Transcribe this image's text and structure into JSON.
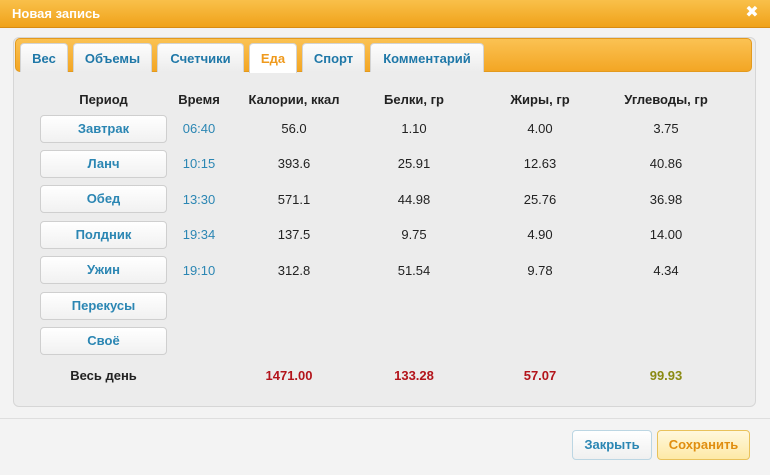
{
  "window": {
    "title": "Новая запись",
    "close_symbol": "✖"
  },
  "tabs": [
    {
      "label": "Вес",
      "active": false
    },
    {
      "label": "Объемы",
      "active": false
    },
    {
      "label": "Счетчики",
      "active": false
    },
    {
      "label": "Еда",
      "active": true
    },
    {
      "label": "Спорт",
      "active": false
    },
    {
      "label": "Комментарий",
      "active": false
    }
  ],
  "columns": [
    "Период",
    "Время",
    "Калории, ккал",
    "Белки, гр",
    "Жиры, гр",
    "Углеводы, гр"
  ],
  "meals": [
    {
      "period": "Завтрак",
      "time": "06:40",
      "calories": "56.0",
      "protein": "1.10",
      "fat": "4.00",
      "carbs": "3.75"
    },
    {
      "period": "Ланч",
      "time": "10:15",
      "calories": "393.6",
      "protein": "25.91",
      "fat": "12.63",
      "carbs": "40.86"
    },
    {
      "period": "Обед",
      "time": "13:30",
      "calories": "571.1",
      "protein": "44.98",
      "fat": "25.76",
      "carbs": "36.98"
    },
    {
      "period": "Полдник",
      "time": "19:34",
      "calories": "137.5",
      "protein": "9.75",
      "fat": "4.90",
      "carbs": "14.00"
    },
    {
      "period": "Ужин",
      "time": "19:10",
      "calories": "312.8",
      "protein": "51.54",
      "fat": "9.78",
      "carbs": "4.34"
    },
    {
      "period": "Перекусы",
      "time": "",
      "calories": "",
      "protein": "",
      "fat": "",
      "carbs": ""
    },
    {
      "period": "Своё",
      "time": "",
      "calories": "",
      "protein": "",
      "fat": "",
      "carbs": ""
    }
  ],
  "totals": {
    "label": "Весь день",
    "calories": "1471.00",
    "protein": "133.28",
    "fat": "57.07",
    "carbs": "99.93"
  },
  "colors": {
    "accent": "#f0a21a",
    "link": "#2b86b3",
    "total_red": "#b3141b",
    "total_olive": "#8a8a12"
  },
  "buttons": {
    "close_label": "Закрыть",
    "save_label": "Сохранить"
  }
}
